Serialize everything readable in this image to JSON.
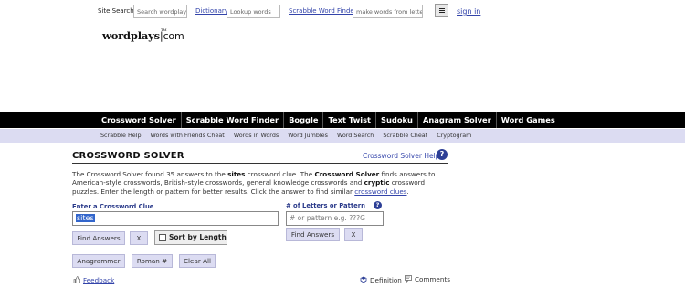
{
  "topbar": {
    "site_search_label": "Site Search",
    "site_search_placeholder": "Search wordplays",
    "dictionary_label": "Dictionary",
    "dictionary_placeholder": "Lookup words",
    "scrabble_label": "Scrabble Word Finder",
    "scrabble_placeholder": "make words from letters",
    "menu_icon": "hamburger-menu-icon",
    "signin": "sign in"
  },
  "logo": {
    "name": "wordplays",
    "tm": "TM",
    "suffix": "com"
  },
  "mainnav": [
    "Crossword Solver",
    "Scrabble Word Finder",
    "Boggle",
    "Text Twist",
    "Sudoku",
    "Anagram Solver",
    "Word Games"
  ],
  "subnav": [
    "Scrabble Help",
    "Words with Friends Cheat",
    "Words in Words",
    "Word Jumbles",
    "Word Search",
    "Scrabble Cheat",
    "Cryptogram"
  ],
  "page": {
    "title": "CROSSWORD SOLVER",
    "help_link": "Crossword Solver Help",
    "desc": {
      "p1": "The Crossword Solver found 35 answers to the ",
      "clue": "sites",
      "p2": " crossword clue. The ",
      "solver": "Crossword Solver",
      "p3": " finds answers to American-style crosswords, British-style crosswords, general knowledge crosswords and ",
      "cryptic": "cryptic",
      "p4": " crossword puzzles. Enter the length or pattern for better results. Click the answer to find similar ",
      "link": "crossword clues",
      "p5": "."
    }
  },
  "form": {
    "clue_label": "Enter a Crossword Clue",
    "clue_value": "sites",
    "pattern_label": "# of Letters or Pattern",
    "pattern_placeholder": "# or pattern e.g. ???G",
    "find_answers": "Find Answers",
    "clear_x": "X",
    "sort_by_length": "Sort by Length",
    "find_answers_2": "Find Answers",
    "clear_x_2": "X",
    "anagrammer": "Anagrammer",
    "roman": "Roman #",
    "clear_all": "Clear All"
  },
  "footer": {
    "feedback": "Feedback",
    "definition": "Definition",
    "comments": "Comments"
  },
  "colors": {
    "nav_bg": "#000000",
    "subnav_bg": "#dcdcf2",
    "link": "#3344aa",
    "label": "#2a3a8a",
    "help_icon": "#2d3f96"
  }
}
